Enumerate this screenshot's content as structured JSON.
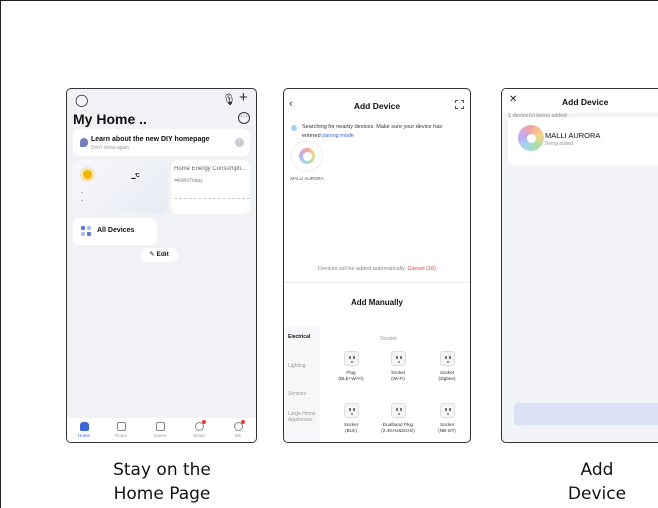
{
  "captions": {
    "left": [
      "Stay on the",
      "Home Page"
    ],
    "right": [
      "Add",
      "Device"
    ]
  },
  "home_screen": {
    "title": "My Home ..",
    "top_icons": [
      "user-icon",
      "microphone-icon",
      "plus-icon"
    ],
    "tip": {
      "title": "Learn about the new DIY homepage",
      "subtitle": "Don't show again"
    },
    "weather": {
      "temp": "--",
      "unit": "°C",
      "dash1": "-",
      "dash2": "-"
    },
    "energy": {
      "title": "Home Energy Consumpti...",
      "value": "--",
      "unit": "kWh/Today"
    },
    "all_devices_label": "All Devices",
    "edit_label": "Edit",
    "tabs": [
      {
        "label": "Home",
        "icon": "home-icon"
      },
      {
        "label": "Room",
        "icon": "room-icon"
      },
      {
        "label": "Scene",
        "icon": "scene-icon"
      },
      {
        "label": "Smart",
        "icon": "smart-icon"
      },
      {
        "label": "Me",
        "icon": "me-icon"
      }
    ]
  },
  "add_device_screen": {
    "title": "Add Device",
    "search_text": "Searching for nearby devices. Make sure your device has entered",
    "search_link": "pairing mode",
    "found_device": "MALLI AURORA",
    "auto_add_text": "Devices will be added automatically.",
    "cancel_text": "Cancel (16)",
    "manual_title": "Add Manually",
    "categories": [
      "Electrical",
      "Lighting",
      "Sensors",
      "Large Home Appliances"
    ],
    "sub_heading": "Socket",
    "items": [
      {
        "name": "Plug",
        "sub": "(BLE+Wi-Fi)"
      },
      {
        "name": "Socket",
        "sub": "(Wi-Fi)"
      },
      {
        "name": "Socket",
        "sub": "(Zigbee)"
      },
      {
        "name": "Socket",
        "sub": "(BLE)"
      },
      {
        "name": "Dualband Plug",
        "sub": "(2.4GHz&5GHz)"
      },
      {
        "name": "Socket",
        "sub": "(NB-IoT)"
      }
    ]
  },
  "adding_screen": {
    "title": "Add Device",
    "adding_text": "1 device(s) being added",
    "device_name": "MALLI AURORA",
    "device_status": "Being added"
  }
}
